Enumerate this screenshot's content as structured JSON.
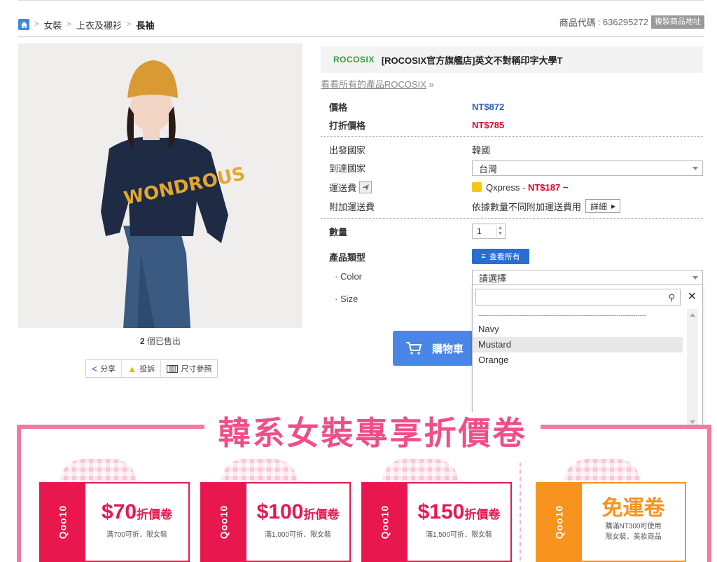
{
  "breadcrumb": {
    "items": [
      "女裝",
      "上衣及襯衫"
    ],
    "current": "長袖"
  },
  "header": {
    "code_label": "商品代碼",
    "code_value": ": 636295272",
    "copy_label": "複製商品地址"
  },
  "product": {
    "brand_logo": "ROCOSIX",
    "title": "[ROCOSIX官方旗艦店]英文不對稱印字大學T",
    "all_products_link": "看看所有的產品ROCOSIX",
    "all_products_arrow": "»",
    "sold_count": "2",
    "sold_text": "個已售出"
  },
  "tools": {
    "share": "分享",
    "report": "投訴",
    "size": "尺寸參照"
  },
  "pricing": {
    "price_label": "價格",
    "price_value": "NT$872",
    "discount_label": "打折價格",
    "discount_value": "NT$785"
  },
  "shipping": {
    "origin_label": "出發國家",
    "origin_value": "韓國",
    "dest_label": "到達國家",
    "dest_value": "台灣",
    "fee_label": "運送費",
    "carrier": "Qxpress -",
    "fee_value": "NT$187 ~",
    "extra_label": "附加運送費",
    "extra_value": "依據數量不同附加運送費用",
    "detail_btn": "詳細"
  },
  "quantity": {
    "label": "數量",
    "value": "1"
  },
  "options": {
    "type_label": "產品類型",
    "view_all": "查看所有",
    "color_label": "· Color",
    "color_placeholder": "請選擇",
    "size_label": "· Size"
  },
  "dropdown": {
    "separator": "--------------------------------------------------------------------------------",
    "items": [
      "Navy",
      "Mustard",
      "Orange"
    ],
    "highlighted": "Mustard"
  },
  "cart": {
    "label": "購物車"
  },
  "banner": {
    "title": "韓系女裝專享折價卷",
    "coupons": [
      {
        "brand": "Qoo10",
        "amount": "$70",
        "unit": "折價卷",
        "cond": "滿700可折．限女裝"
      },
      {
        "brand": "Qoo10",
        "amount": "$100",
        "unit": "折價卷",
        "cond": "滿1,000可折．限女裝"
      },
      {
        "brand": "Qoo10",
        "amount": "$150",
        "unit": "折價卷",
        "cond": "滿1,500可折．限女裝"
      },
      {
        "brand": "Qoo10",
        "amount": "免運卷",
        "unit": "",
        "cond": "購滿NT300可使用",
        "cond2": "限女裝．美妝商品"
      }
    ]
  },
  "colors": {
    "blue": "#2b5db8",
    "red": "#e4002b",
    "pink": "#f07ba1",
    "coupon_red": "#e8184f",
    "coupon_orange": "#f7931e",
    "brand_green": "#2aa33a"
  }
}
